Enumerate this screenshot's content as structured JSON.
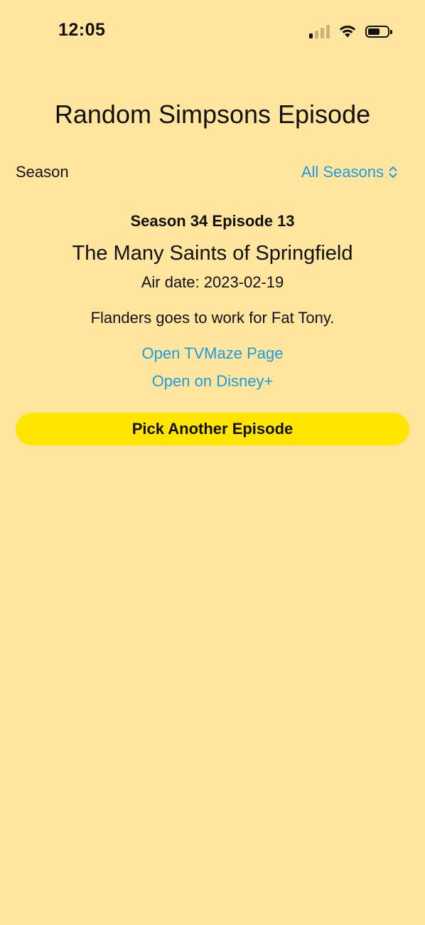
{
  "status_bar": {
    "time": "12:05",
    "signal_bars_active": 1,
    "signal_bars_total": 4,
    "battery_level": 0.6
  },
  "title": "Random Simpsons Episode",
  "season_filter": {
    "label": "Season",
    "value": "All Seasons",
    "icon": "chevron-up-down-icon"
  },
  "episode": {
    "number_line": "Season 34 Episode 13",
    "title": "The Many Saints of Springfield",
    "air_date": "Air date: 2023-02-19",
    "summary": "Flanders goes to work for Fat Tony."
  },
  "links": {
    "tvmaze": "Open TVMaze Page",
    "disney": "Open on Disney+"
  },
  "button": {
    "label": "Pick Another Episode"
  },
  "colors": {
    "background": "#FFE59D",
    "accent_link": "#1E9BE0",
    "button": "#FFE500"
  }
}
